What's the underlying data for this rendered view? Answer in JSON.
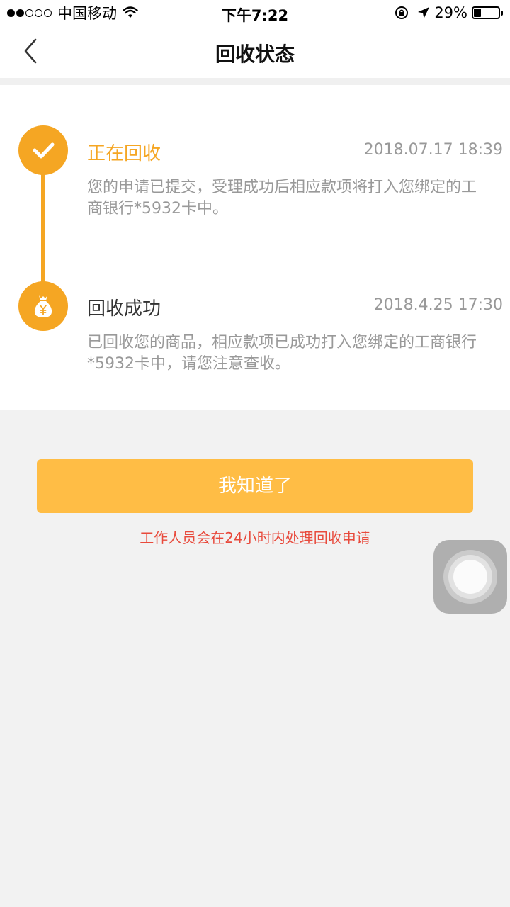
{
  "status_bar": {
    "carrier": "中国移动",
    "time": "下午7:22",
    "battery": "29%",
    "battery_level": 0.29
  },
  "nav": {
    "title": "回收状态"
  },
  "timeline": [
    {
      "title": "正在回收",
      "time": "2018.07.17 18:39",
      "desc": "您的申请已提交，受理成功后相应款项将打入您绑定的工商银行*5932卡中。",
      "icon": "check-icon"
    },
    {
      "title": "回收成功",
      "time": "2018.4.25 17:30",
      "desc": "已回收您的商品，相应款项已成功打入您绑定的工商银行*5932卡中，请您注意查收。",
      "icon": "money-bag-icon"
    }
  ],
  "button": {
    "label": "我知道了"
  },
  "notice": "工作人员会在24小时内处理回收申请",
  "colors": {
    "accent": "#f5a623",
    "button": "#ffbd45",
    "notice": "#e84a3c"
  }
}
